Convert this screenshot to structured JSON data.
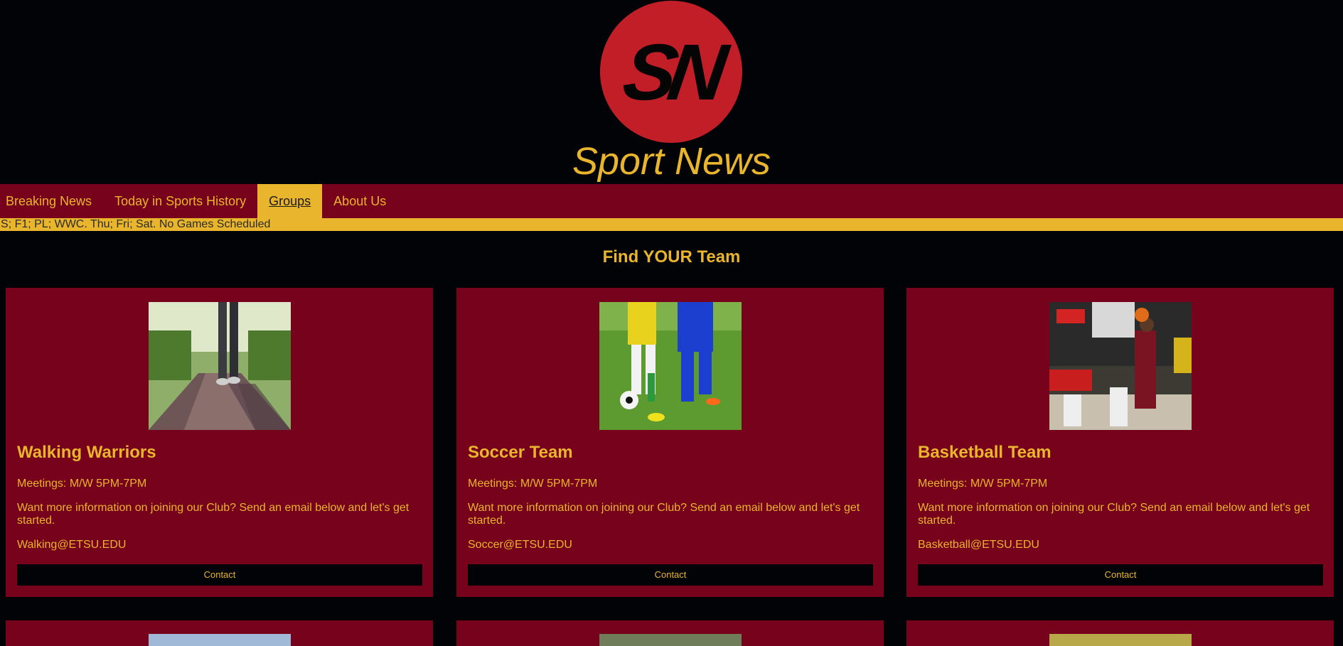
{
  "header": {
    "logo_letters": "SN",
    "site_title": "Sport News"
  },
  "nav": {
    "items": [
      {
        "label": "Breaking News"
      },
      {
        "label": "Today in Sports History"
      },
      {
        "label": "Groups",
        "active": true
      },
      {
        "label": "About Us"
      }
    ]
  },
  "ticker": {
    "text": "S; F1; PL; WWC. Thu; Fri; Sat. No Games Scheduled"
  },
  "section": {
    "title": "Find YOUR Team"
  },
  "cards": [
    {
      "title": "Walking Warriors",
      "meetings": "Meetings: M/W 5PM-7PM",
      "description": "Want more information on joining our Club? Send an email below and let's get started.",
      "email": "Walking@ETSU.EDU",
      "button": "Contact",
      "image": "running-photo"
    },
    {
      "title": "Soccer Team",
      "meetings": "Meetings: M/W 5PM-7PM",
      "description": "Want more information on joining our Club? Send an email below and let's get started.",
      "email": "Soccer@ETSU.EDU",
      "button": "Contact",
      "image": "soccer-photo"
    },
    {
      "title": "Basketball Team",
      "meetings": "Meetings: M/W 5PM-7PM",
      "description": "Want more information on joining our Club? Send an email below and let's get started.",
      "email": "Basketball@ETSU.EDU",
      "button": "Contact",
      "image": "basketball-photo"
    }
  ],
  "colors": {
    "background": "#020306",
    "maroon": "#76021c",
    "gold": "#e9b52c",
    "logo_red": "#c21e27"
  }
}
